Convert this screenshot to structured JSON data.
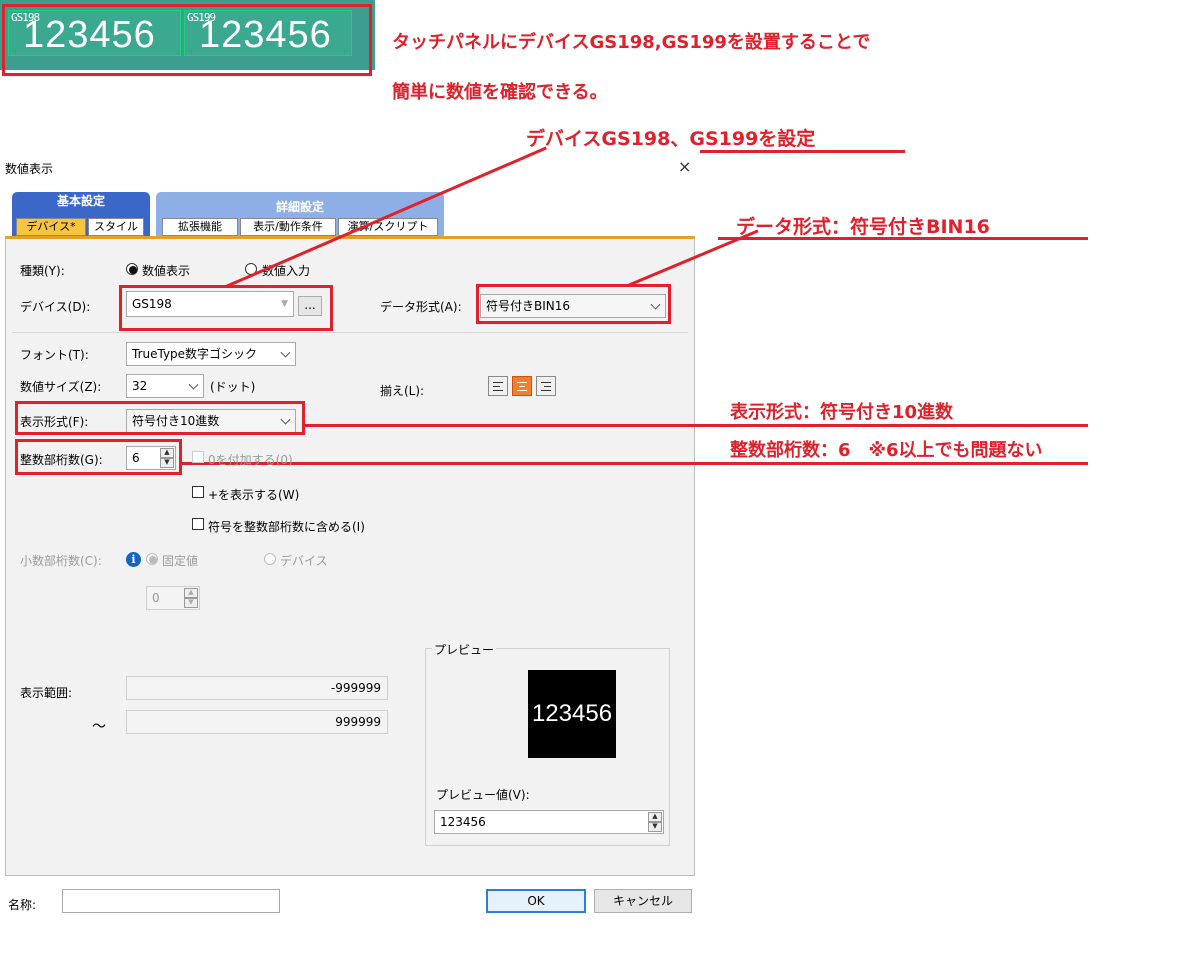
{
  "top_preview": {
    "tiles": [
      {
        "device": "GS198",
        "value": "123456"
      },
      {
        "device": "GS199",
        "value": "123456"
      }
    ]
  },
  "annotations": {
    "note1_line1": "タッチパネルにデバイスGS198,GS199を設置することで",
    "note1_line2": "簡単に数値を確認できる。",
    "note_device": "デバイスGS198、GS199を設定",
    "note_dataformat": "データ形式：符号付きBIN16",
    "note_displayformat": "表示形式：符号付き10進数",
    "note_digits": "整数部桁数：6　※6以上でも問題ない"
  },
  "dialog": {
    "title": "数値表示",
    "close": "×",
    "tab_groups": [
      {
        "label": "基本設定",
        "tabs": [
          "デバイス*",
          "スタイル"
        ]
      },
      {
        "label": "詳細設定",
        "tabs": [
          "拡張機能",
          "表示/動作条件",
          "演算/スクリプト"
        ]
      }
    ],
    "kind_label": "種類(Y):",
    "kind_options": [
      "数値表示",
      "数値入力"
    ],
    "kind_selected": "数値表示",
    "device_label": "デバイス(D):",
    "device_value": "GS198",
    "browse": "...",
    "dataformat_label": "データ形式(A):",
    "dataformat_value": "符号付きBIN16",
    "font_label": "フォント(T):",
    "font_value": "TrueType数字ゴシック",
    "size_label": "数値サイズ(Z):",
    "size_value": "32",
    "size_unit": "(ドット)",
    "align_label": "揃え(L):",
    "display_format_label": "表示形式(F):",
    "display_format_value": "符号付き10進数",
    "int_digits_label": "整数部桁数(G):",
    "int_digits_value": "6",
    "zero_pad_label": "0を付加する(0)",
    "plus_label": "+を表示する(W)",
    "sign_in_digits_label": "符号を整数部桁数に含める(I)",
    "decimal_label": "小数部桁数(C):",
    "decimal_options": [
      "固定値",
      "デバイス"
    ],
    "decimal_value": "0",
    "range_label": "表示範囲:",
    "range_min": "-999999",
    "range_tilde": "～",
    "range_max": "999999",
    "preview_label": "プレビュー",
    "preview_display": "123456",
    "preview_value_label": "プレビュー値(V):",
    "preview_value": "123456",
    "name_label": "名称:",
    "name_value": "",
    "ok": "OK",
    "cancel": "キャンセル"
  },
  "colors": {
    "annotation_red": "#e0202a",
    "tab_blue": "#3b68c8",
    "tab_active_yellow": "#f6c53c",
    "align_active_orange": "#f08030"
  }
}
